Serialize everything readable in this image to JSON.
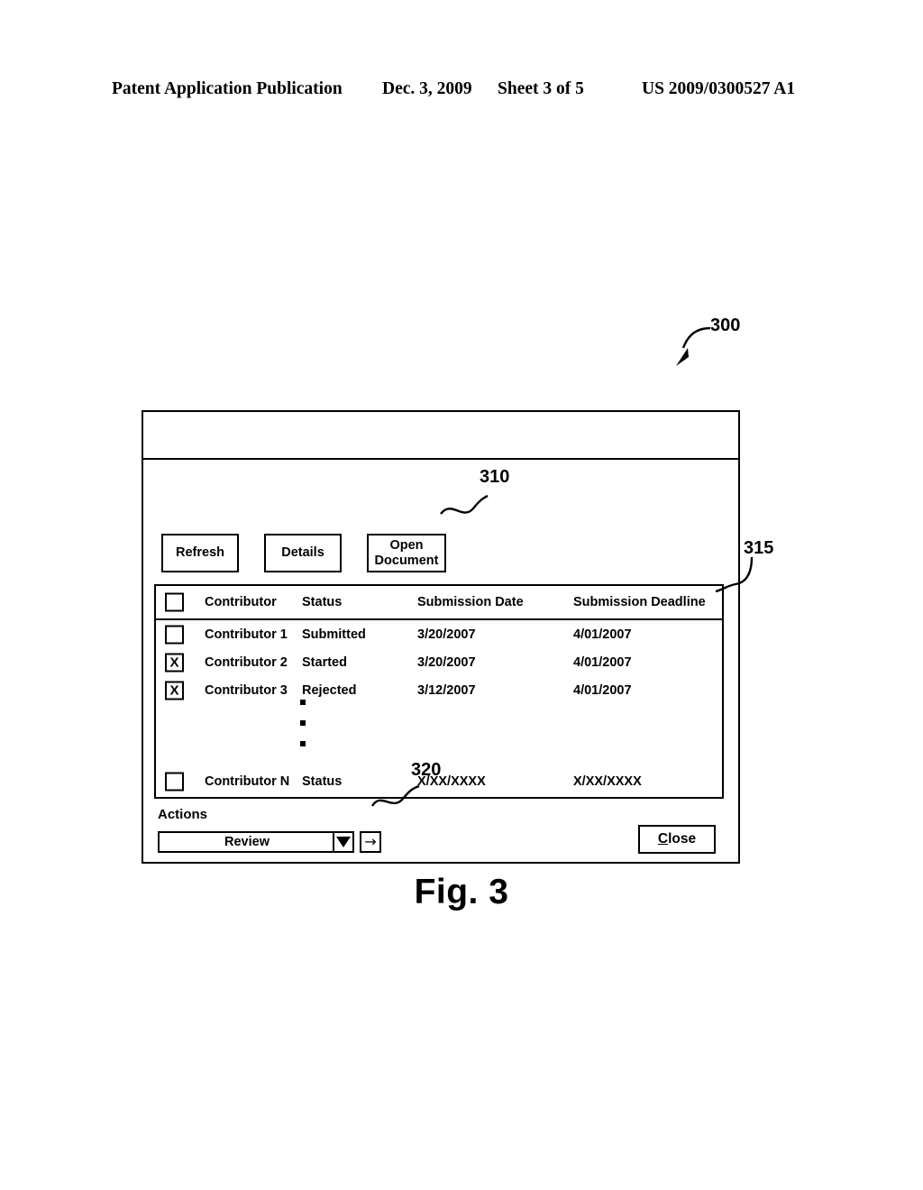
{
  "page_header": {
    "publication": "Patent Application Publication",
    "date": "Dec. 3, 2009",
    "sheet": "Sheet 3 of 5",
    "patent_number": "US 2009/0300527 A1"
  },
  "figure": {
    "caption": "Fig. 3"
  },
  "reference_numerals": {
    "dialog": "300",
    "toolbar": "310",
    "grid": "315",
    "actions": "320"
  },
  "dialog": {
    "titlebar": {
      "title": ""
    },
    "toolbar": {
      "buttons": [
        {
          "label": "Refresh",
          "lines": [
            "Refresh"
          ]
        },
        {
          "label": "Details",
          "lines": [
            "Details"
          ]
        },
        {
          "label": "Open Document",
          "lines": [
            "Open",
            "Document"
          ]
        }
      ]
    },
    "grid": {
      "columns": [
        "Contributor",
        "Status",
        "Submission Date",
        "Submission Deadline"
      ],
      "select_all_checked": false,
      "rows": [
        {
          "checked": false,
          "contributor": "Contributor 1",
          "status": "Submitted",
          "submission_date": "3/20/2007",
          "submission_deadline": "4/01/2007"
        },
        {
          "checked": true,
          "contributor": "Contributor 2",
          "status": "Started",
          "submission_date": "3/20/2007",
          "submission_deadline": "4/01/2007"
        },
        {
          "checked": true,
          "contributor": "Contributor 3",
          "status": "Rejected",
          "submission_date": "3/12/2007",
          "submission_deadline": "4/01/2007"
        }
      ],
      "ellipsis": "vertical-dots",
      "last_row": {
        "checked": false,
        "contributor": "Contributor N",
        "status": "Status",
        "submission_date": "X/XX/XXXX",
        "submission_deadline": "X/XX/XXXX"
      },
      "checkbox_checked_glyph": "X"
    },
    "actions": {
      "label": "Actions",
      "dropdown_value": "Review",
      "dropdown_icon": "triangle-down-icon",
      "go_label": "→"
    },
    "footer": {
      "close_mnemonic": "C",
      "close_rest": "lose"
    }
  },
  "colors": {
    "ink": "#000000",
    "paper": "#ffffff"
  }
}
